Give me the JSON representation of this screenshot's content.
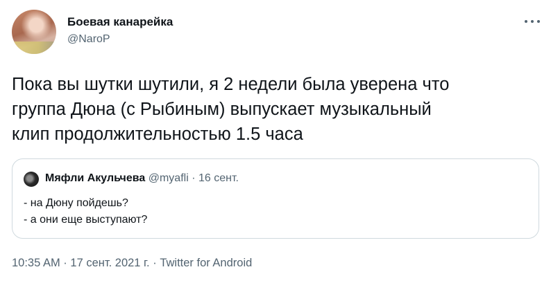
{
  "author": {
    "name": "Боевая канарейка",
    "handle": "@NaroP"
  },
  "tweet": {
    "text": "Пока вы шутки шутили, я 2 недели была уверена что\nгруппа Дюна (с Рыбиным) выпускает музыкальный\nклип продолжительностью 1.5 часа"
  },
  "quoted": {
    "name": "Мяфли Акульчева",
    "handle": "@myafli",
    "separator": " · ",
    "date": "16 сент.",
    "line1": "- на Дюну пойдешь?",
    "line2": "- а они еще выступают?"
  },
  "footer": {
    "time": "10:35 AM",
    "separator": " · ",
    "date": "17 сент. 2021 г.",
    "source": "Twitter for Android"
  },
  "icons": {
    "more": "more-horizontal-icon"
  }
}
